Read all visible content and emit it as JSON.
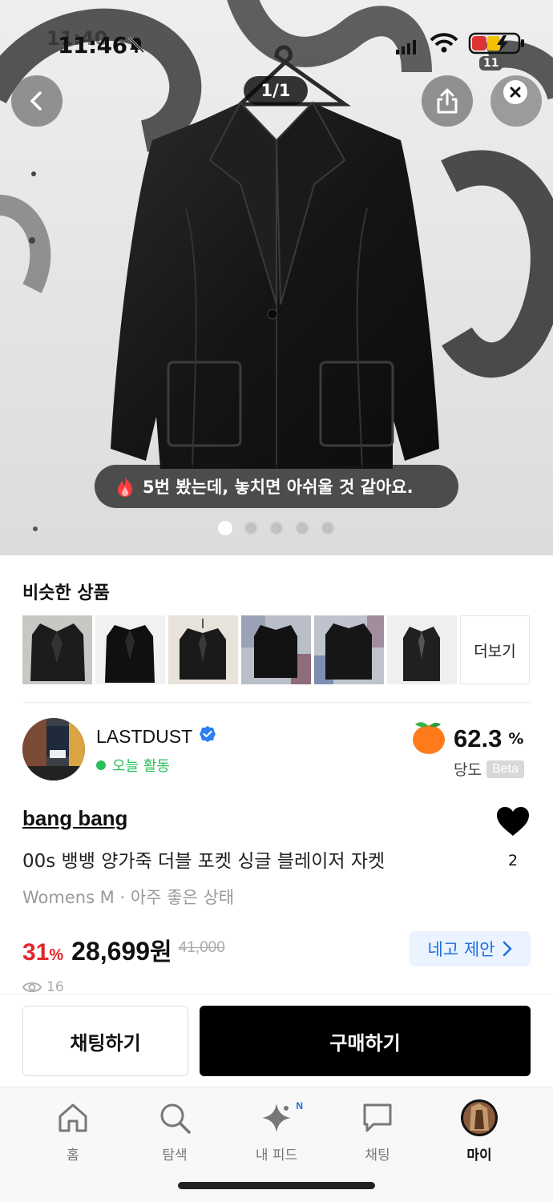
{
  "status_bar": {
    "time": "11:46",
    "time_overlay": "11:40",
    "battery_level": "11"
  },
  "hero": {
    "counter": "1/1",
    "toast": "5번 봤는데, 놓치면 아쉬울 것 같아요.",
    "carousel_count": 5,
    "carousel_active_index": 0
  },
  "similar": {
    "title": "비슷한 상품",
    "more_label": "더보기"
  },
  "seller": {
    "name": "LASTDUST",
    "activity": "오늘 활동",
    "score": "62.3",
    "score_unit": "%",
    "score_label": "당도",
    "beta_label": "Beta"
  },
  "product": {
    "brand": "bang bang",
    "title": "00s 뱅뱅 양가죽 더블 포켓 싱글 블레이저 자켓",
    "meta": "Womens M · 아주 좋은 상태",
    "like_count": "2",
    "discount": "31",
    "discount_unit": "%",
    "price": "28,699",
    "price_unit": "원",
    "original_price": "41,000",
    "offer_label": "네고 제안",
    "views": "16"
  },
  "actions": {
    "chat_label": "채팅하기",
    "buy_label": "구매하기"
  },
  "tabbar": {
    "tabs": [
      {
        "label": "홈",
        "icon": "home-icon"
      },
      {
        "label": "탐색",
        "icon": "search-icon"
      },
      {
        "label": "내 피드",
        "icon": "sparkle-icon",
        "badge": "N"
      },
      {
        "label": "채팅",
        "icon": "chat-bubble-icon"
      },
      {
        "label": "마이",
        "icon": "profile-avatar-icon"
      }
    ]
  },
  "colors": {
    "accent_blue": "#1e6fe0",
    "discount_red": "#e3262c",
    "online_green": "#2bbf5a",
    "buy_button": "#000000"
  }
}
